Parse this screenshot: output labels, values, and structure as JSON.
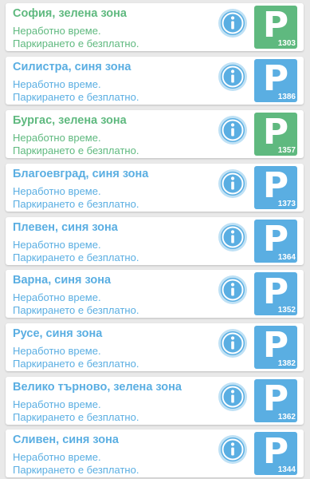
{
  "colors": {
    "green": "#5fb97f",
    "blue": "#5aaee2",
    "info_fill": "#5aaee2",
    "info_ring": "#bfe1f5"
  },
  "icons": {
    "info": "info-icon",
    "parking": "parking-icon"
  },
  "zones": [
    {
      "city": "София, зелена зона",
      "zone": "green",
      "status": "Неработно време.",
      "note": "Паркирането е безплатно.",
      "sms": "1303"
    },
    {
      "city": "Силистра, синя зона",
      "zone": "blue",
      "status": "Неработно време.",
      "note": "Паркирането е безплатно.",
      "sms": "1386"
    },
    {
      "city": "Бургас, зелена зона",
      "zone": "green",
      "status": "Неработно време.",
      "note": "Паркирането е безплатно.",
      "sms": "1357"
    },
    {
      "city": "Благоевград, синя зона",
      "zone": "blue",
      "status": "Неработно време.",
      "note": "Паркирането е безплатно.",
      "sms": "1373"
    },
    {
      "city": "Плевен, синя зона",
      "zone": "blue",
      "status": "Неработно време.",
      "note": "Паркирането е безплатно.",
      "sms": "1364"
    },
    {
      "city": "Варна, синя зона",
      "zone": "blue",
      "status": "Неработно време.",
      "note": "Паркирането е безплатно.",
      "sms": "1352"
    },
    {
      "city": "Русе, синя зона",
      "zone": "blue",
      "status": "Неработно време.",
      "note": "Паркирането е безплатно.",
      "sms": "1382"
    },
    {
      "city": "Велико търново, зелена зона",
      "zone": "blue",
      "status": "Неработно време.",
      "note": "Паркирането е безплатно.",
      "sms": "1362"
    },
    {
      "city": "Сливен, синя зона",
      "zone": "blue",
      "status": "Неработно време.",
      "note": "Паркирането е безплатно.",
      "sms": "1344"
    }
  ]
}
